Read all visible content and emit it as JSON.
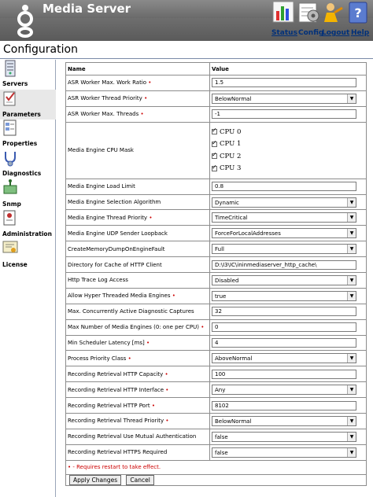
{
  "header": {
    "app_title": "Media Server",
    "nav": [
      {
        "label": "Status",
        "current": false
      },
      {
        "label": "Config",
        "current": true
      },
      {
        "label": "Logout",
        "current": false
      },
      {
        "label": "Help",
        "current": false
      }
    ]
  },
  "page_title": "Configuration",
  "sidebar": {
    "items": [
      {
        "label": "Servers",
        "icon": "servers-icon",
        "active": false
      },
      {
        "label": "Parameters",
        "icon": "parameters-icon",
        "active": true
      },
      {
        "label": "Properties",
        "icon": "properties-icon",
        "active": false
      },
      {
        "label": "Diagnostics",
        "icon": "diagnostics-icon",
        "active": false
      },
      {
        "label": "Snmp",
        "icon": "snmp-icon",
        "active": false
      },
      {
        "label": "Administration",
        "icon": "administration-icon",
        "active": false
      },
      {
        "label": "License",
        "icon": "license-icon",
        "active": false
      }
    ]
  },
  "table": {
    "col_name": "Name",
    "col_value": "Value",
    "rows": [
      {
        "name": "ASR Worker Max. Work Ratio",
        "req": true,
        "type": "input",
        "value": "1.5"
      },
      {
        "name": "ASR Worker Thread Priority",
        "req": true,
        "type": "select",
        "value": "BelowNormal"
      },
      {
        "name": "ASR Worker Max. Threads",
        "req": true,
        "type": "input",
        "value": "-1"
      },
      {
        "name": "Media Engine CPU Mask",
        "req": false,
        "type": "cpu",
        "value": [
          "CPU 0",
          "CPU 1",
          "CPU 2",
          "CPU 3"
        ]
      },
      {
        "name": "Media Engine Load Limit",
        "req": false,
        "type": "input",
        "value": "0.8"
      },
      {
        "name": "Media Engine Selection Algorithm",
        "req": false,
        "type": "select",
        "value": "Dynamic"
      },
      {
        "name": "Media Engine Thread Priority",
        "req": true,
        "type": "select",
        "value": "TimeCritical"
      },
      {
        "name": "Media Engine UDP Sender Loopback",
        "req": false,
        "type": "select",
        "value": "ForceForLocalAddresses"
      },
      {
        "name": "CreateMemoryDumpOnEngineFault",
        "req": false,
        "type": "select",
        "value": "Full"
      },
      {
        "name": "Directory for Cache of HTTP Client",
        "req": false,
        "type": "input",
        "value": "D:\\I3\\IC\\ininmediaserver_http_cache\\"
      },
      {
        "name": "Http Trace Log Access",
        "req": false,
        "type": "select",
        "value": "Disabled"
      },
      {
        "name": "Allow Hyper Threaded Media Engines",
        "req": true,
        "type": "select",
        "value": "true"
      },
      {
        "name": "Max. Concurrently Active Diagnostic Captures",
        "req": false,
        "type": "input",
        "value": "32"
      },
      {
        "name": "Max Number of Media Engines (0: one per CPU)",
        "req": true,
        "type": "input",
        "value": "0"
      },
      {
        "name": "Min Scheduler Latency [ms]",
        "req": true,
        "type": "input",
        "value": "4"
      },
      {
        "name": "Process Priority Class",
        "req": true,
        "type": "select",
        "value": "AboveNormal"
      },
      {
        "name": "Recording Retrieval HTTP Capacity",
        "req": true,
        "type": "input",
        "value": "100"
      },
      {
        "name": "Recording Retrieval HTTP Interface",
        "req": true,
        "type": "select",
        "value": "Any"
      },
      {
        "name": "Recording Retrieval HTTP Port",
        "req": true,
        "type": "input",
        "value": "8102"
      },
      {
        "name": "Recording Retrieval Thread Priority",
        "req": true,
        "type": "select",
        "value": "BelowNormal"
      },
      {
        "name": "Recording Retrieval Use Mutual Authentication",
        "req": false,
        "type": "select",
        "value": "false"
      },
      {
        "name": "Recording Retrieval HTTPS Required",
        "req": false,
        "type": "select",
        "value": "false"
      }
    ],
    "req_marker": "•",
    "note": "• - Requires restart to take effect.",
    "apply_label": "Apply Changes",
    "cancel_label": "Cancel"
  }
}
